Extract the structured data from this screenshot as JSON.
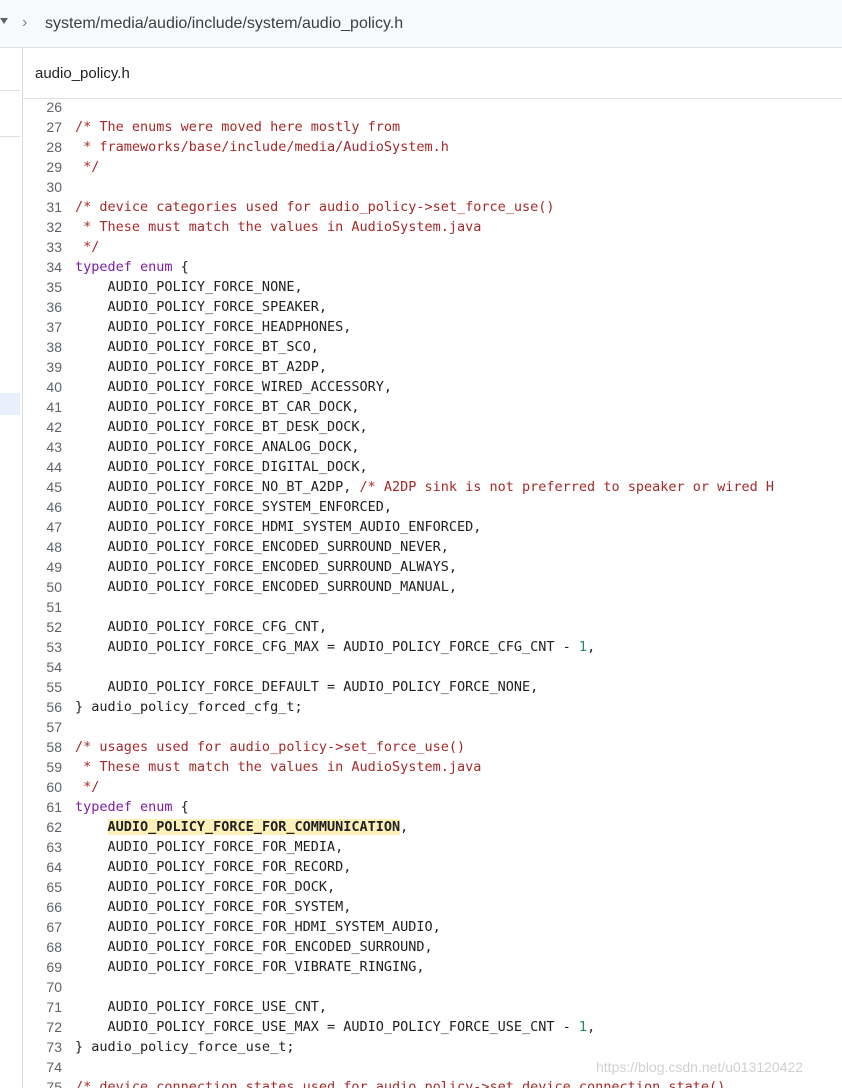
{
  "breadcrumb": {
    "path": "system/media/audio/include/system/audio_policy.h"
  },
  "file_tab": {
    "name": "audio_policy.h"
  },
  "watermark": "https://blog.csdn.net/u013120422",
  "code_lines": [
    {
      "n": "26",
      "segs": []
    },
    {
      "n": "27",
      "segs": [
        {
          "t": "/* The enums were moved here mostly from",
          "c": "cm"
        }
      ]
    },
    {
      "n": "28",
      "segs": [
        {
          "t": " * frameworks/base/include/media/AudioSystem.h",
          "c": "cm"
        }
      ]
    },
    {
      "n": "29",
      "segs": [
        {
          "t": " */",
          "c": "cm"
        }
      ]
    },
    {
      "n": "30",
      "segs": []
    },
    {
      "n": "31",
      "segs": [
        {
          "t": "/* device categories used for audio_policy->set_force_use()",
          "c": "cm"
        }
      ]
    },
    {
      "n": "32",
      "segs": [
        {
          "t": " * These must match the values in AudioSystem.java",
          "c": "cm"
        }
      ]
    },
    {
      "n": "33",
      "segs": [
        {
          "t": " */",
          "c": "cm"
        }
      ]
    },
    {
      "n": "34",
      "segs": [
        {
          "t": "typedef enum",
          "c": "kw"
        },
        {
          "t": " {",
          "c": ""
        }
      ]
    },
    {
      "n": "35",
      "segs": [
        {
          "t": "    AUDIO_POLICY_FORCE_NONE,",
          "c": ""
        }
      ]
    },
    {
      "n": "36",
      "segs": [
        {
          "t": "    AUDIO_POLICY_FORCE_SPEAKER,",
          "c": ""
        }
      ]
    },
    {
      "n": "37",
      "segs": [
        {
          "t": "    AUDIO_POLICY_FORCE_HEADPHONES,",
          "c": ""
        }
      ]
    },
    {
      "n": "38",
      "segs": [
        {
          "t": "    AUDIO_POLICY_FORCE_BT_SCO,",
          "c": ""
        }
      ]
    },
    {
      "n": "39",
      "segs": [
        {
          "t": "    AUDIO_POLICY_FORCE_BT_A2DP,",
          "c": ""
        }
      ]
    },
    {
      "n": "40",
      "segs": [
        {
          "t": "    AUDIO_POLICY_FORCE_WIRED_ACCESSORY,",
          "c": ""
        }
      ]
    },
    {
      "n": "41",
      "segs": [
        {
          "t": "    AUDIO_POLICY_FORCE_BT_CAR_DOCK,",
          "c": ""
        }
      ]
    },
    {
      "n": "42",
      "segs": [
        {
          "t": "    AUDIO_POLICY_FORCE_BT_DESK_DOCK,",
          "c": ""
        }
      ]
    },
    {
      "n": "43",
      "segs": [
        {
          "t": "    AUDIO_POLICY_FORCE_ANALOG_DOCK,",
          "c": ""
        }
      ]
    },
    {
      "n": "44",
      "segs": [
        {
          "t": "    AUDIO_POLICY_FORCE_DIGITAL_DOCK,",
          "c": ""
        }
      ]
    },
    {
      "n": "45",
      "segs": [
        {
          "t": "    AUDIO_POLICY_FORCE_NO_BT_A2DP, ",
          "c": ""
        },
        {
          "t": "/* A2DP sink is not preferred to speaker or wired H",
          "c": "cm"
        }
      ]
    },
    {
      "n": "46",
      "segs": [
        {
          "t": "    AUDIO_POLICY_FORCE_SYSTEM_ENFORCED,",
          "c": ""
        }
      ]
    },
    {
      "n": "47",
      "segs": [
        {
          "t": "    AUDIO_POLICY_FORCE_HDMI_SYSTEM_AUDIO_ENFORCED,",
          "c": ""
        }
      ]
    },
    {
      "n": "48",
      "segs": [
        {
          "t": "    AUDIO_POLICY_FORCE_ENCODED_SURROUND_NEVER,",
          "c": ""
        }
      ]
    },
    {
      "n": "49",
      "segs": [
        {
          "t": "    AUDIO_POLICY_FORCE_ENCODED_SURROUND_ALWAYS,",
          "c": ""
        }
      ]
    },
    {
      "n": "50",
      "segs": [
        {
          "t": "    AUDIO_POLICY_FORCE_ENCODED_SURROUND_MANUAL,",
          "c": ""
        }
      ]
    },
    {
      "n": "51",
      "segs": []
    },
    {
      "n": "52",
      "segs": [
        {
          "t": "    AUDIO_POLICY_FORCE_CFG_CNT,",
          "c": ""
        }
      ]
    },
    {
      "n": "53",
      "segs": [
        {
          "t": "    AUDIO_POLICY_FORCE_CFG_MAX = AUDIO_POLICY_FORCE_CFG_CNT - ",
          "c": ""
        },
        {
          "t": "1",
          "c": "nm"
        },
        {
          "t": ",",
          "c": ""
        }
      ]
    },
    {
      "n": "54",
      "segs": []
    },
    {
      "n": "55",
      "segs": [
        {
          "t": "    AUDIO_POLICY_FORCE_DEFAULT = AUDIO_POLICY_FORCE_NONE,",
          "c": ""
        }
      ]
    },
    {
      "n": "56",
      "segs": [
        {
          "t": "} audio_policy_forced_cfg_t;",
          "c": ""
        }
      ]
    },
    {
      "n": "57",
      "segs": []
    },
    {
      "n": "58",
      "segs": [
        {
          "t": "/* usages used for audio_policy->set_force_use()",
          "c": "cm"
        }
      ]
    },
    {
      "n": "59",
      "segs": [
        {
          "t": " * These must match the values in AudioSystem.java",
          "c": "cm"
        }
      ]
    },
    {
      "n": "60",
      "segs": [
        {
          "t": " */",
          "c": "cm"
        }
      ]
    },
    {
      "n": "61",
      "segs": [
        {
          "t": "typedef enum",
          "c": "kw"
        },
        {
          "t": " {",
          "c": ""
        }
      ]
    },
    {
      "n": "62",
      "segs": [
        {
          "t": "    ",
          "c": ""
        },
        {
          "t": "AUDIO_POLICY_FORCE_FOR_COMMUNICATION",
          "c": "hl"
        },
        {
          "t": ",",
          "c": ""
        }
      ]
    },
    {
      "n": "63",
      "segs": [
        {
          "t": "    AUDIO_POLICY_FORCE_FOR_MEDIA,",
          "c": ""
        }
      ]
    },
    {
      "n": "64",
      "segs": [
        {
          "t": "    AUDIO_POLICY_FORCE_FOR_RECORD,",
          "c": ""
        }
      ]
    },
    {
      "n": "65",
      "segs": [
        {
          "t": "    AUDIO_POLICY_FORCE_FOR_DOCK,",
          "c": ""
        }
      ]
    },
    {
      "n": "66",
      "segs": [
        {
          "t": "    AUDIO_POLICY_FORCE_FOR_SYSTEM,",
          "c": ""
        }
      ]
    },
    {
      "n": "67",
      "segs": [
        {
          "t": "    AUDIO_POLICY_FORCE_FOR_HDMI_SYSTEM_AUDIO,",
          "c": ""
        }
      ]
    },
    {
      "n": "68",
      "segs": [
        {
          "t": "    AUDIO_POLICY_FORCE_FOR_ENCODED_SURROUND,",
          "c": ""
        }
      ]
    },
    {
      "n": "69",
      "segs": [
        {
          "t": "    AUDIO_POLICY_FORCE_FOR_VIBRATE_RINGING,",
          "c": ""
        }
      ]
    },
    {
      "n": "70",
      "segs": []
    },
    {
      "n": "71",
      "segs": [
        {
          "t": "    AUDIO_POLICY_FORCE_USE_CNT,",
          "c": ""
        }
      ]
    },
    {
      "n": "72",
      "segs": [
        {
          "t": "    AUDIO_POLICY_FORCE_USE_MAX = AUDIO_POLICY_FORCE_USE_CNT - ",
          "c": ""
        },
        {
          "t": "1",
          "c": "nm"
        },
        {
          "t": ",",
          "c": ""
        }
      ]
    },
    {
      "n": "73",
      "segs": [
        {
          "t": "} audio_policy_force_use_t;",
          "c": ""
        }
      ]
    },
    {
      "n": "74",
      "segs": []
    },
    {
      "n": "75",
      "segs": [
        {
          "t": "/* device connection states used for audio_policy->set_device_connection_state()",
          "c": "cm"
        }
      ]
    }
  ]
}
